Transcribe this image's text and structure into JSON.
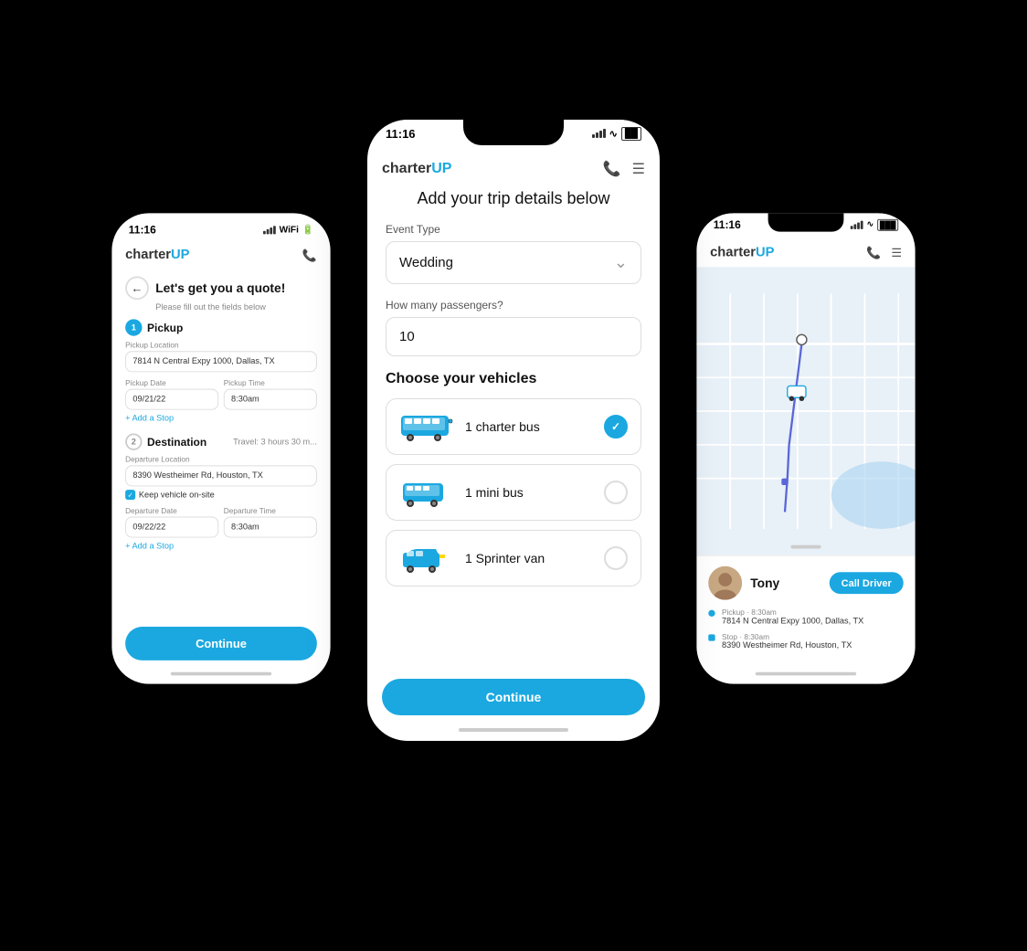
{
  "app": {
    "logo_charter": "charter",
    "logo_up": "UP",
    "time": "11:16"
  },
  "left_phone": {
    "title": "Let's get you a quote!",
    "subtitle": "Please fill out the fields below",
    "back_label": "←",
    "step1": {
      "number": "1",
      "label": "Pickup",
      "location_label": "Pickup Location",
      "location_value": "7814 N Central Expy 1000, Dallas, TX",
      "date_label": "Pickup Date",
      "date_value": "09/21/22",
      "time_label": "Pickup Time",
      "time_value": "8:30am",
      "add_stop": "+ Add a Stop"
    },
    "step2": {
      "number": "2",
      "label": "Destination",
      "travel_info": "Travel: 3 hours 30 m...",
      "location_label": "Departure Location",
      "location_value": "8390 Westheimer Rd, Houston, TX",
      "keep_vehicle": "Keep vehicle on-site",
      "date_label": "Departure Date",
      "date_value": "09/22/22",
      "time_label": "Departure Time",
      "time_value": "8:30am",
      "add_stop": "+ Add a Stop"
    },
    "continue_label": "Continue"
  },
  "center_phone": {
    "title": "Add your trip details below",
    "event_type_label": "Event Type",
    "event_type_value": "Wedding",
    "passengers_label": "How many passengers?",
    "passengers_value": "10",
    "vehicles_title": "Choose your vehicles",
    "vehicles": [
      {
        "name": "1 charter bus",
        "selected": true
      },
      {
        "name": "1 mini bus",
        "selected": false
      },
      {
        "name": "1 Sprinter van",
        "selected": false
      }
    ],
    "continue_label": "Continue",
    "chevron": "⌄"
  },
  "right_phone": {
    "driver": {
      "name": "Tony",
      "call_label": "Call Driver"
    },
    "stops": [
      {
        "type": "pickup",
        "time": "Pickup · 8:30am",
        "address": "7814 N Central Expy 1000, Dallas, TX"
      },
      {
        "type": "stop",
        "time": "Stop · 8:30am",
        "address": "8390 Westheimer Rd, Houston, TX"
      }
    ]
  }
}
